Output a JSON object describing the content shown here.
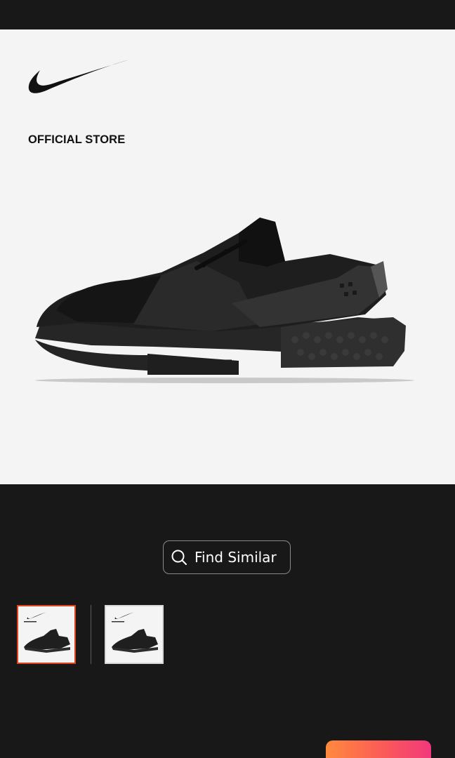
{
  "brand": {
    "logo_icon": "nike-swoosh-icon",
    "label": "OFFICIAL STORE"
  },
  "product": {
    "image": "black-running-shoe-image"
  },
  "actions": {
    "find_similar_label": "Find Similar",
    "find_similar_icon": "search-icon"
  },
  "gallery": {
    "thumbnails": [
      {
        "selected": true
      },
      {
        "selected": false
      }
    ]
  },
  "colors": {
    "background": "#181818",
    "hero_background": "#f4f4f4",
    "selected_thumb_border": "#e2431d",
    "cta_gradient_start": "#ff8a3d",
    "cta_gradient_end": "#f1387d"
  }
}
